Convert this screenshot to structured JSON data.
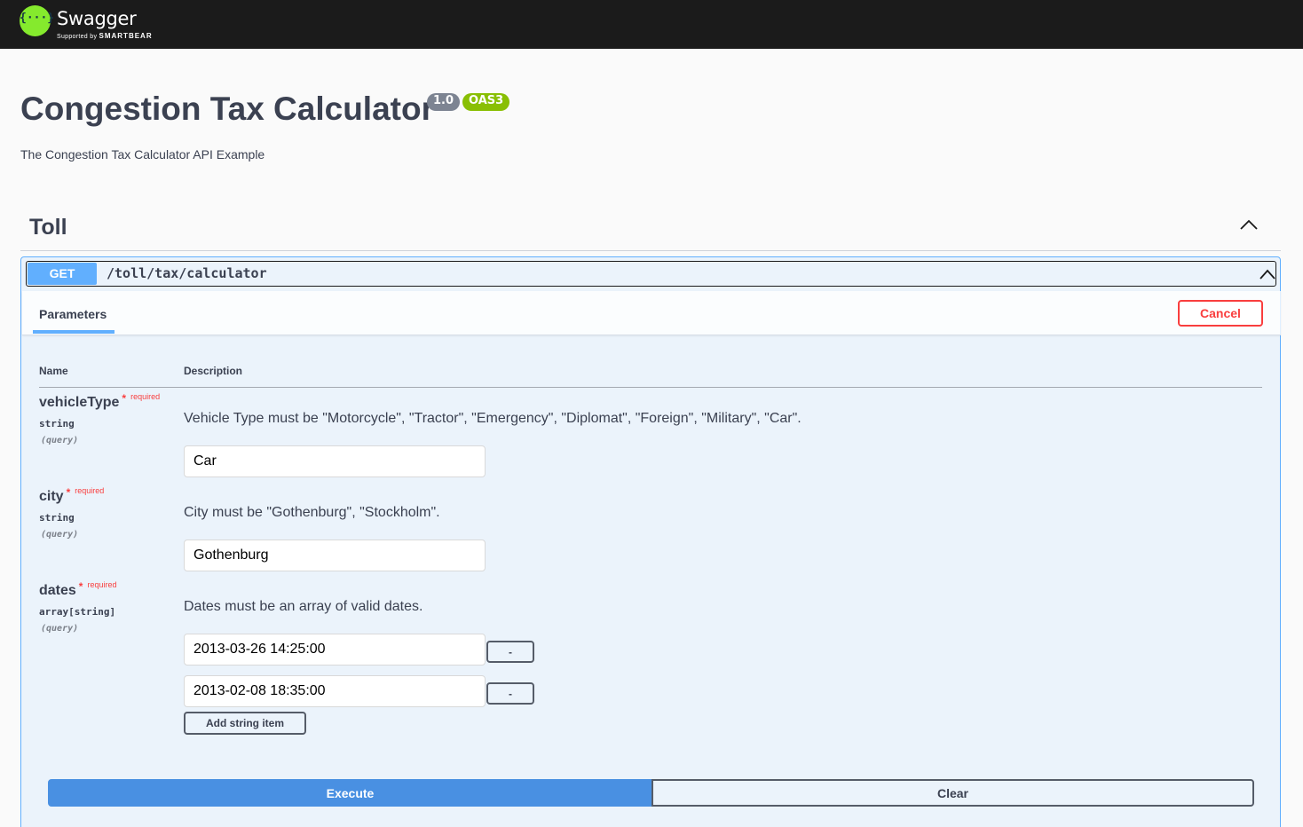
{
  "topbar": {
    "logo_symbol": "{···}",
    "brand": "Swagger",
    "tagline_prefix": "Supported by",
    "tagline_company": "SMARTBEAR"
  },
  "info": {
    "title": "Congestion Tax Calculator",
    "version": "1.0",
    "spec": "OAS3",
    "description": "The Congestion Tax Calculator API Example"
  },
  "tag": {
    "name": "Toll",
    "icon": "chevron-up-icon"
  },
  "operation": {
    "method": "GET",
    "path": "/toll/tax/calculator",
    "icon": "chevron-up-icon",
    "params_tab": "Parameters",
    "cancel_label": "Cancel",
    "col_name": "Name",
    "col_description": "Description",
    "params": [
      {
        "name": "vehicleType",
        "star": "*",
        "required": "required",
        "type": "string",
        "in": "(query)",
        "description": "Vehicle Type must be \"Motorcycle\", \"Tractor\", \"Emergency\", \"Diplomat\", \"Foreign\", \"Military\", \"Car\".",
        "value": "Car"
      },
      {
        "name": "city",
        "star": "*",
        "required": "required",
        "type": "string",
        "in": "(query)",
        "description": "City must be \"Gothenburg\", \"Stockholm\".",
        "value": "Gothenburg"
      },
      {
        "name": "dates",
        "star": "*",
        "required": "required",
        "type": "array[string]",
        "in": "(query)",
        "description": "Dates must be an array of valid dates.",
        "values": [
          "2013-03-26 14:25:00",
          "2013-02-08 18:35:00"
        ],
        "remove_label": "-",
        "add_label": "Add string item"
      }
    ],
    "execute_label": "Execute",
    "clear_label": "Clear"
  },
  "colors": {
    "get": "#61affe",
    "execute": "#4990e2",
    "cancel": "#f93e3e",
    "logo": "#85ea2d",
    "oas_badge": "#89bf04"
  }
}
